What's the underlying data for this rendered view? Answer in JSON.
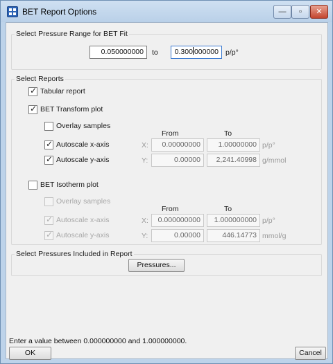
{
  "window": {
    "title": "BET Report Options",
    "controls": {
      "minimize": "—",
      "maximize": "▫",
      "close": "✕"
    }
  },
  "pressure_range": {
    "group_label": "Select Pressure Range for BET Fit",
    "from_value": "0.050000000",
    "to_label": "to",
    "to_value_before_caret": "0.300",
    "to_value_after_caret": "000000",
    "unit": "p/p°"
  },
  "reports": {
    "group_label": "Select Reports",
    "tabular": {
      "label": "Tabular report",
      "checked": true
    },
    "transform": {
      "label": "BET Transform plot",
      "checked": true,
      "overlay": {
        "label": "Overlay samples",
        "checked": false
      },
      "from_header": "From",
      "to_header": "To",
      "x_axis": {
        "label": "Autoscale x-axis",
        "checked": true,
        "axis": "X:",
        "from": "0.00000000",
        "to": "1.00000000",
        "unit": "p/p°"
      },
      "y_axis": {
        "label": "Autoscale y-axis",
        "checked": true,
        "axis": "Y:",
        "from": "0.00000",
        "to": "2,241.40998",
        "unit": "g/mmol"
      }
    },
    "isotherm": {
      "label": "BET Isotherm plot",
      "checked": false,
      "overlay": {
        "label": "Overlay samples",
        "checked": false
      },
      "from_header": "From",
      "to_header": "To",
      "x_axis": {
        "label": "Autoscale x-axis",
        "checked": true,
        "axis": "X:",
        "from": "0.000000000",
        "to": "1.000000000",
        "unit": "p/p°"
      },
      "y_axis": {
        "label": "Autoscale y-axis",
        "checked": true,
        "axis": "Y:",
        "from": "0.00000",
        "to": "446.14773",
        "unit": "mmol/g"
      }
    }
  },
  "pressures": {
    "group_label": "Select Pressures Included in Report",
    "button": "Pressures..."
  },
  "status_text": "Enter a value between 0.000000000 and 1.000000000.",
  "buttons": {
    "ok": "OK",
    "cancel": "Cancel"
  },
  "check_glyph": "✓"
}
